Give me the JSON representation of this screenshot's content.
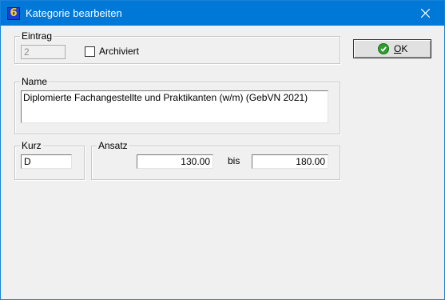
{
  "window": {
    "title": "Kategorie bearbeiten"
  },
  "eintrag": {
    "legend": "Eintrag",
    "value": "2",
    "archiviert_label": "Archiviert",
    "archiviert_checked": false
  },
  "name": {
    "legend": "Name",
    "value": "Diplomierte Fachangestellte und Praktikanten (w/m) (GebVN 2021)"
  },
  "kurz": {
    "legend": "Kurz",
    "value": "D"
  },
  "ansatz": {
    "legend": "Ansatz",
    "from": "130.00",
    "bis_label": "bis",
    "to": "180.00"
  },
  "buttons": {
    "ok_mnemonic": "O",
    "ok_rest": "K"
  },
  "icons": {
    "app": "app-6-icon",
    "close": "close-icon",
    "ok": "check-circle-icon"
  },
  "colors": {
    "titlebar": "#0078d7",
    "ok_icon": "#2e9d2e"
  }
}
